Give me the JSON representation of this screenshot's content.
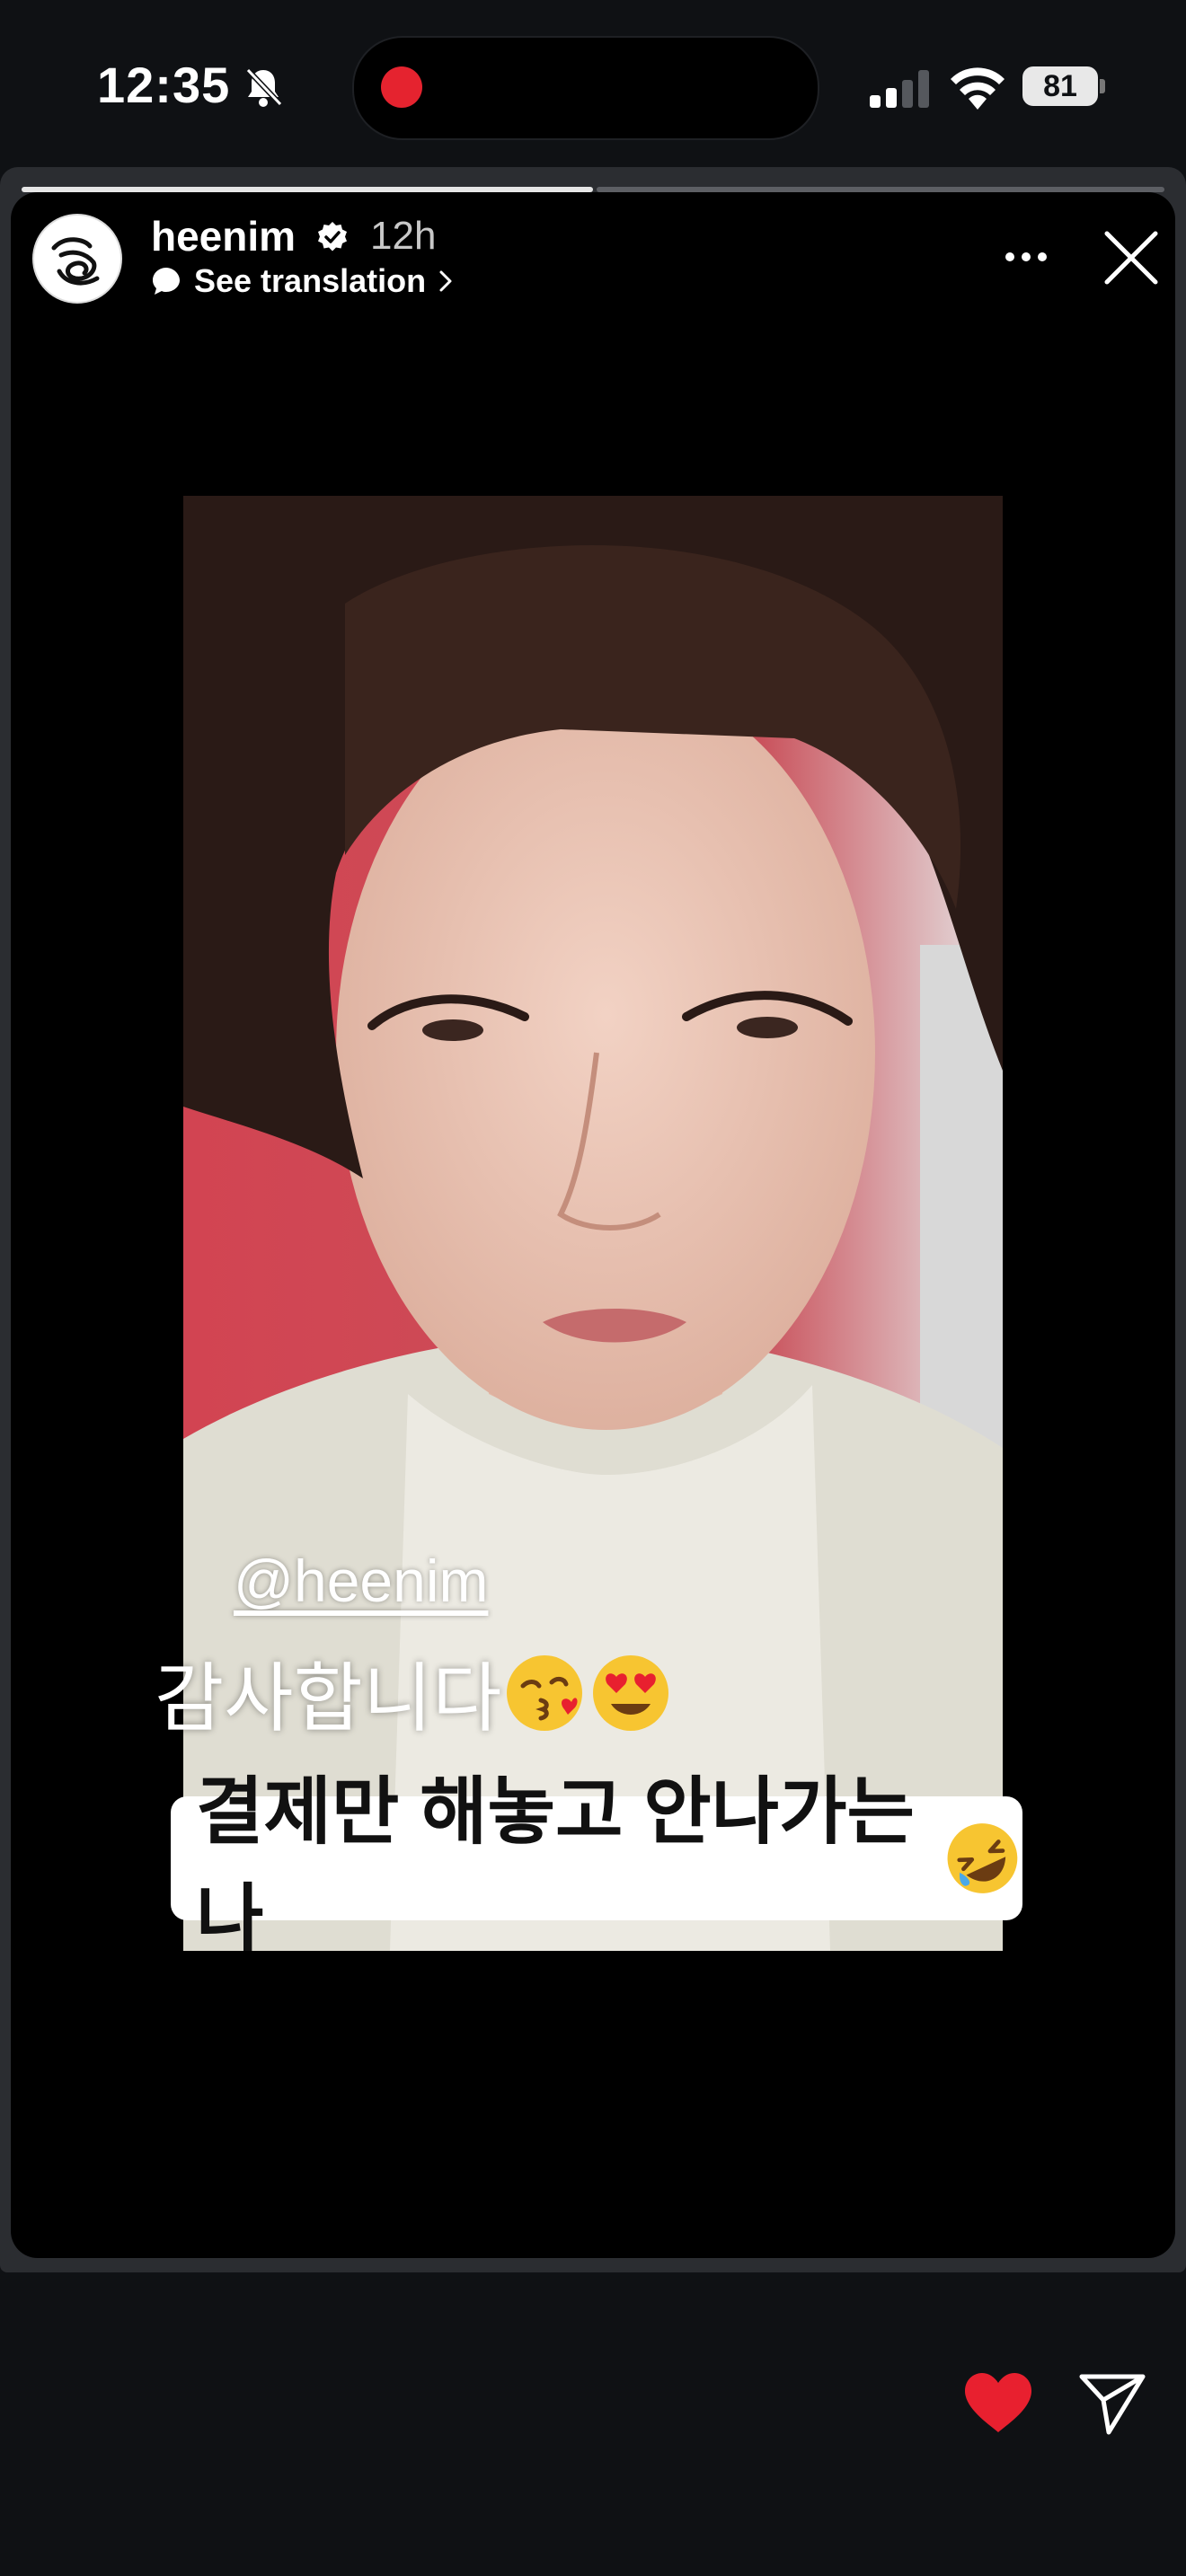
{
  "status_bar": {
    "time": "12:35",
    "battery": "81",
    "icons": [
      "bell-slash-icon",
      "signal-icon",
      "wifi-icon",
      "battery-icon"
    ]
  },
  "story": {
    "username": "heenim",
    "verified": true,
    "time_ago": "12h",
    "see_translation": "See translation",
    "progress": {
      "segments": 2,
      "current": 1
    },
    "mention": "@heenim",
    "overlay_text": "감사합니다",
    "caption": "결제만 해놓고 안나가는 나",
    "icons": [
      "more-icon",
      "close-icon",
      "kiss-emoji",
      "heart-eyes-emoji",
      "rofl-emoji"
    ]
  },
  "actions": {
    "liked": true,
    "icons": [
      "heart-icon",
      "send-icon"
    ]
  },
  "colors": {
    "background": "#0f1114",
    "like": "#e8202f",
    "recording": "#e5232f"
  }
}
